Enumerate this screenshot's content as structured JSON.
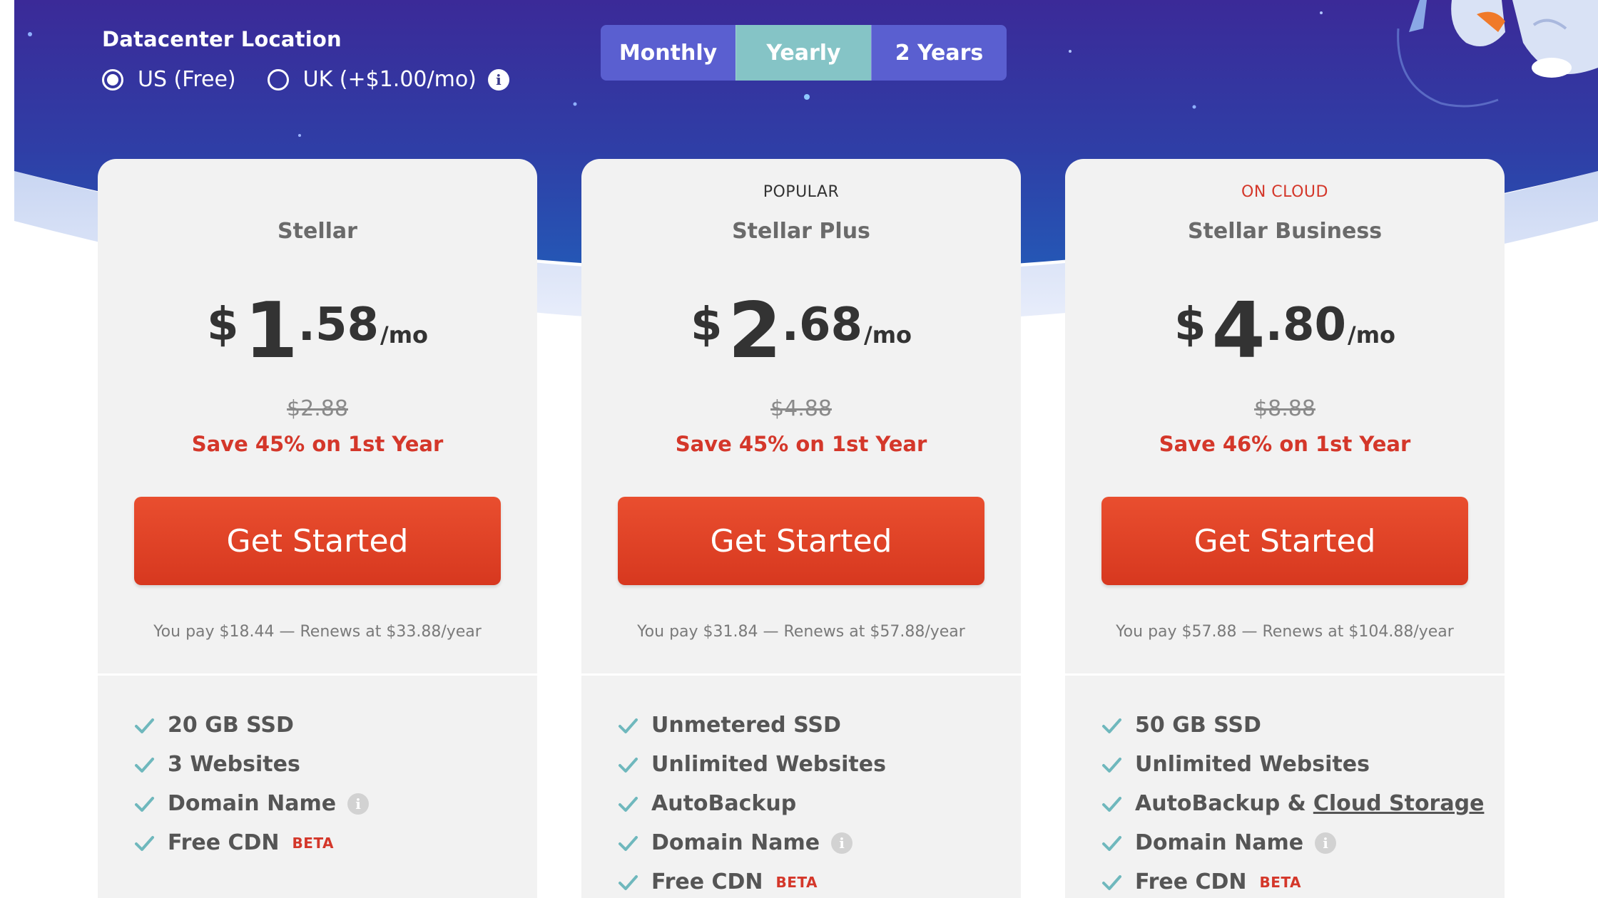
{
  "datacenter": {
    "title": "Datacenter Location",
    "options": [
      {
        "label": "US (Free)",
        "selected": true
      },
      {
        "label": "UK (+$1.00/mo)",
        "selected": false
      }
    ]
  },
  "billing": {
    "tabs": [
      {
        "label": "Monthly",
        "active": false
      },
      {
        "label": "Yearly",
        "active": true
      },
      {
        "label": "2 Years",
        "active": false
      }
    ]
  },
  "plans": [
    {
      "badge": "",
      "name": "Stellar",
      "price": {
        "currency": "$",
        "dollars": "1",
        "cents": ".58",
        "period": "/mo"
      },
      "old_price": "$2.88",
      "save_text": "Save 45% on 1st Year",
      "cta": "Get Started",
      "pay_note": "You pay $18.44 — Renews at $33.88/year",
      "features": [
        {
          "text": "20 GB SSD"
        },
        {
          "text": "3 Websites"
        },
        {
          "text": "Domain Name"
        },
        {
          "text": "Free CDN",
          "badge": "BETA"
        }
      ]
    },
    {
      "badge": "POPULAR",
      "name": "Stellar Plus",
      "price": {
        "currency": "$",
        "dollars": "2",
        "cents": ".68",
        "period": "/mo"
      },
      "old_price": "$4.88",
      "save_text": "Save 45% on 1st Year",
      "cta": "Get Started",
      "pay_note": "You pay $31.84 — Renews at $57.88/year",
      "features": [
        {
          "text": "Unmetered SSD"
        },
        {
          "text": "Unlimited Websites"
        },
        {
          "text": "AutoBackup"
        },
        {
          "text": "Domain Name"
        },
        {
          "text": "Free CDN",
          "badge": "BETA"
        }
      ]
    },
    {
      "badge": "ON CLOUD",
      "name": "Stellar Business",
      "price": {
        "currency": "$",
        "dollars": "4",
        "cents": ".80",
        "period": "/mo"
      },
      "old_price": "$8.88",
      "save_text": "Save 46% on 1st Year",
      "cta": "Get Started",
      "pay_note": "You pay $57.88 — Renews at $104.88/year",
      "features": [
        {
          "text": "50 GB SSD"
        },
        {
          "text": "Unlimited Websites"
        },
        {
          "text": "AutoBackup &",
          "link": "Cloud Storage"
        },
        {
          "text": "Domain Name"
        },
        {
          "text": "Free CDN",
          "badge": "BETA"
        }
      ]
    }
  ],
  "icons": {
    "check": "check-icon",
    "info": "info-icon",
    "mascot": "mascot-illustration"
  },
  "colors": {
    "accent_red": "#d4372a",
    "button_red": "#e4462a",
    "active_tab": "#85c4c6",
    "tab_bg": "#5a5fd0",
    "check_teal": "#6fb8bd",
    "hero_dark": "#3a2a96",
    "hero_light": "#2f4fb0"
  }
}
